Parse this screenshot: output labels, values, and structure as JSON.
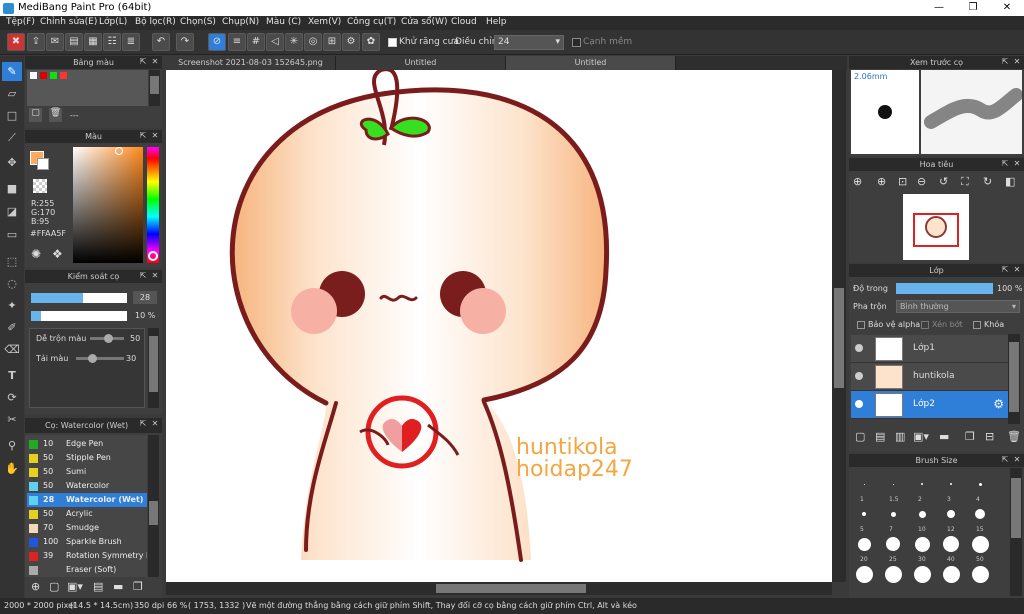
{
  "window": {
    "title": "MediBang Paint Pro (64bit)",
    "minimize": "—",
    "maximize": "❐",
    "close": "✕"
  },
  "menu": [
    "Tệp(F)",
    "Chỉnh sửa(E)",
    "Lớp(L)",
    "Bộ lọc(R)",
    "Chọn(S)",
    "Chụp(N)",
    "Màu (C)",
    "Xem(V)",
    "Công cụ(T)",
    "Cửa sổ(W)",
    "Cloud",
    "Help"
  ],
  "toolbar": {
    "antialias_label": "Khử răng cưa",
    "adjust_label": "Điều chỉnh",
    "adjust_value": "24",
    "smooth_label": "Cạnh mềm"
  },
  "palette_panel": {
    "title": "Bảng màu",
    "dash": "---"
  },
  "color_panel": {
    "title": "Màu",
    "r": "R:255",
    "g": "G:170",
    "b": "B:95",
    "hex": "#FFAA5F",
    "fg_color": "#FFAA5F"
  },
  "brush_control": {
    "title": "Kiểm soát cọ",
    "size_value": "28",
    "opacity_value": "10 %",
    "mix_label": "Dễ trộn màu",
    "mix_value": "50",
    "reload_label": "Tải màu",
    "reload_value": "30"
  },
  "brush_panel": {
    "title": "Cọ: Watercolor (Wet)",
    "items": [
      {
        "size": "10",
        "name": "Edge Pen",
        "color": "#22aa22"
      },
      {
        "size": "50",
        "name": "Stipple Pen",
        "color": "#e6d020"
      },
      {
        "size": "50",
        "name": "Sumi",
        "color": "#e6d020"
      },
      {
        "size": "50",
        "name": "Watercolor",
        "color": "#5fd0f0"
      },
      {
        "size": "28",
        "name": "Watercolor (Wet)",
        "color": "#5fd0f0"
      },
      {
        "size": "50",
        "name": "Acrylic",
        "color": "#e6d020"
      },
      {
        "size": "70",
        "name": "Smudge",
        "color": "#f3d9b5"
      },
      {
        "size": "100",
        "name": "Sparkle Brush",
        "color": "#2255dd"
      },
      {
        "size": "39",
        "name": "Rotation Symmetry P",
        "color": "#dd2222"
      },
      {
        "size": "",
        "name": "Eraser (Soft)",
        "color": "#aaaaaa"
      }
    ]
  },
  "tabs": [
    "Screenshot 2021-08-03 152645.png",
    "Untitled",
    "Untitled"
  ],
  "canvas": {
    "watermark_line1": "huntikola",
    "watermark_line2": "hoidap247"
  },
  "preview_panel": {
    "title": "Xem trước cọ",
    "size_label": "2.06mm"
  },
  "navigator_panel": {
    "title": "Hoa tiêu"
  },
  "layer_panel": {
    "title": "Lớp",
    "opacity_label": "Độ trong",
    "opacity_value": "100 %",
    "opacity_fraction": 1.0,
    "blend_label": "Pha trộn",
    "blend_value": "Bình thường",
    "protect_label": "Bảo vệ alpha",
    "clip_label": "Xén bớt",
    "lock_label": "Khóa",
    "layers": [
      "Lớp1",
      "huntikola",
      "Lớp2"
    ]
  },
  "brush_size_panel": {
    "title": "Brush Size",
    "labels": [
      "1",
      "1.5",
      "2",
      "3",
      "4",
      "5",
      "7",
      "10",
      "12",
      "15",
      "20",
      "25",
      "30",
      "40",
      "50"
    ]
  },
  "status": {
    "dims": "2000 * 2000 pixel",
    "physical": "(14.5 * 14.5cm)",
    "dpi": "350 dpi",
    "zoom": "66 %",
    "coords": "( 1753, 1332 )",
    "hint": "Vẽ một đường thẳng bằng cách giữ phím Shift, Thay đổi cỡ cọ bằng cách giữ phím Ctrl, Alt và kéo"
  }
}
